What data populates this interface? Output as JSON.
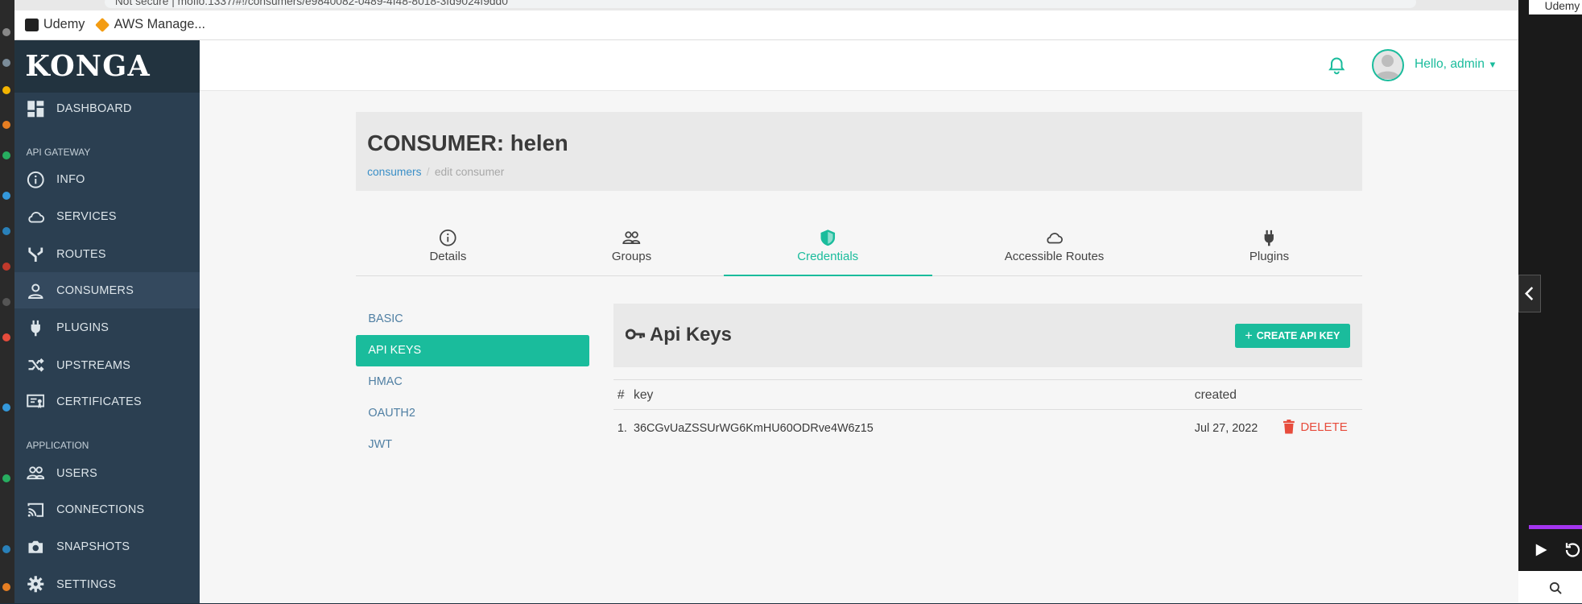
{
  "browser": {
    "url_text": "Not secure | mofio:1337/#!/consumers/e9840082-0489-4f48-8018-3fd9024f9dd0",
    "bookmarks": [
      {
        "label": "Udemy",
        "icon": "udemy-icon"
      },
      {
        "label": "AWS Manage...",
        "icon": "aws-icon"
      }
    ]
  },
  "sidebar": {
    "logo": "KONGA",
    "sections": {
      "api_gateway": "API GATEWAY",
      "application": "APPLICATION"
    },
    "items": [
      {
        "label": "DASHBOARD",
        "icon": "dashboard-icon"
      },
      {
        "label": "INFO",
        "icon": "info-icon"
      },
      {
        "label": "SERVICES",
        "icon": "cloud-icon"
      },
      {
        "label": "ROUTES",
        "icon": "routes-icon"
      },
      {
        "label": "CONSUMERS",
        "icon": "user-icon"
      },
      {
        "label": "PLUGINS",
        "icon": "plug-icon"
      },
      {
        "label": "UPSTREAMS",
        "icon": "shuffle-icon"
      },
      {
        "label": "CERTIFICATES",
        "icon": "certificate-icon"
      },
      {
        "label": "USERS",
        "icon": "users-icon"
      },
      {
        "label": "CONNECTIONS",
        "icon": "cast-icon"
      },
      {
        "label": "SNAPSHOTS",
        "icon": "camera-icon"
      },
      {
        "label": "SETTINGS",
        "icon": "gear-icon"
      }
    ]
  },
  "header": {
    "greeting": "Hello, admin"
  },
  "consumer": {
    "title": "CONSUMER: helen",
    "breadcrumb": {
      "link": "consumers",
      "current": "edit consumer"
    }
  },
  "tabs": [
    {
      "label": "Details",
      "icon": "info-icon"
    },
    {
      "label": "Groups",
      "icon": "users-icon"
    },
    {
      "label": "Credentials",
      "icon": "shield-icon"
    },
    {
      "label": "Accessible Routes",
      "icon": "cloud-icon"
    },
    {
      "label": "Plugins",
      "icon": "plug-icon"
    }
  ],
  "credentials": {
    "types": [
      "BASIC",
      "API KEYS",
      "HMAC",
      "OAUTH2",
      "JWT"
    ],
    "active": "API KEYS"
  },
  "apikeys": {
    "title": "Api Keys",
    "create_button": "CREATE API KEY",
    "columns": {
      "num": "#",
      "key": "key",
      "created": "created"
    },
    "rows": [
      {
        "num": "1.",
        "key": "36CGvUaZSSUrWG6KmHU60ODRve4W6z15",
        "created": "Jul 27, 2022",
        "action": "DELETE"
      }
    ]
  },
  "overlay": {
    "tab_label": "Udemy"
  },
  "colors": {
    "accent": "#1abc9c",
    "sidebar": "#2b3f51",
    "danger": "#e74c3c",
    "link": "#3a8fc7"
  }
}
